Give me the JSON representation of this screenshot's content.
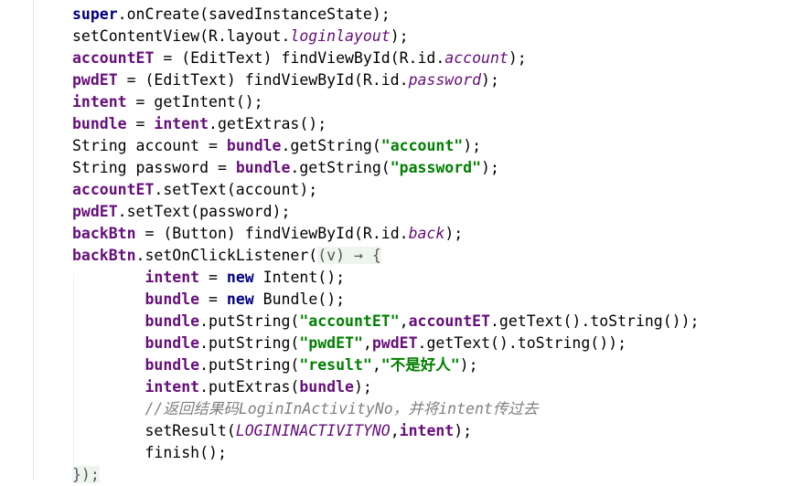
{
  "editor": {
    "lines": [
      [
        {
          "t": "super",
          "c": "kw"
        },
        {
          "t": ".onCreate(savedInstanceState);"
        }
      ],
      [
        {
          "t": "setContentView(R.layout."
        },
        {
          "t": "loginlayout",
          "c": "ifld"
        },
        {
          "t": ");"
        }
      ],
      [
        {
          "t": "accountET",
          "c": "fld"
        },
        {
          "t": " = (EditText) findViewById(R.id."
        },
        {
          "t": "account",
          "c": "ifld"
        },
        {
          "t": ");"
        }
      ],
      [
        {
          "t": "pwdET",
          "c": "fld"
        },
        {
          "t": " = (EditText) findViewById(R.id."
        },
        {
          "t": "password",
          "c": "ifld"
        },
        {
          "t": ");"
        }
      ],
      [
        {
          "t": "intent",
          "c": "fld"
        },
        {
          "t": " = getIntent();"
        }
      ],
      [
        {
          "t": "bundle",
          "c": "fld"
        },
        {
          "t": " = "
        },
        {
          "t": "intent",
          "c": "fld"
        },
        {
          "t": ".getExtras();"
        }
      ],
      [
        {
          "t": "String account = "
        },
        {
          "t": "bundle",
          "c": "fld"
        },
        {
          "t": ".getString("
        },
        {
          "t": "\"account\"",
          "c": "str"
        },
        {
          "t": ");"
        }
      ],
      [
        {
          "t": "String password = "
        },
        {
          "t": "bundle",
          "c": "fld"
        },
        {
          "t": ".getString("
        },
        {
          "t": "\"password\"",
          "c": "str"
        },
        {
          "t": ");"
        }
      ],
      [
        {
          "t": "accountET",
          "c": "fld"
        },
        {
          "t": ".setText(account);"
        }
      ],
      [
        {
          "t": "pwdET",
          "c": "fld"
        },
        {
          "t": ".setText(password);"
        }
      ],
      [
        {
          "t": "backBtn",
          "c": "fld"
        },
        {
          "t": " = (Button) findViewById(R.id."
        },
        {
          "t": "back",
          "c": "ifld"
        },
        {
          "t": ");"
        }
      ],
      [
        {
          "t": "backBtn",
          "c": "fld"
        },
        {
          "t": ".setOnClickListener("
        },
        {
          "t": "(v) → {",
          "c": "lam"
        }
      ],
      [
        {
          "t": "        "
        },
        {
          "t": "intent",
          "c": "fld"
        },
        {
          "t": " = "
        },
        {
          "t": "new",
          "c": "kw"
        },
        {
          "t": " Intent();"
        }
      ],
      [
        {
          "t": "        "
        },
        {
          "t": "bundle",
          "c": "fld"
        },
        {
          "t": " = "
        },
        {
          "t": "new",
          "c": "kw"
        },
        {
          "t": " Bundle();"
        }
      ],
      [
        {
          "t": "        "
        },
        {
          "t": "bundle",
          "c": "fld"
        },
        {
          "t": ".putString("
        },
        {
          "t": "\"accountET\"",
          "c": "str"
        },
        {
          "t": ","
        },
        {
          "t": "accountET",
          "c": "fld"
        },
        {
          "t": ".getText().toString());"
        }
      ],
      [
        {
          "t": "        "
        },
        {
          "t": "bundle",
          "c": "fld"
        },
        {
          "t": ".putString("
        },
        {
          "t": "\"pwdET\"",
          "c": "str"
        },
        {
          "t": ","
        },
        {
          "t": "pwdET",
          "c": "fld"
        },
        {
          "t": ".getText().toString());"
        }
      ],
      [
        {
          "t": "        "
        },
        {
          "t": "bundle",
          "c": "fld"
        },
        {
          "t": ".putString("
        },
        {
          "t": "\"result\"",
          "c": "str"
        },
        {
          "t": ","
        },
        {
          "t": "\"不是好人\"",
          "c": "str"
        },
        {
          "t": ");"
        }
      ],
      [
        {
          "t": "        "
        },
        {
          "t": "intent",
          "c": "fld"
        },
        {
          "t": ".putExtras("
        },
        {
          "t": "bundle",
          "c": "fld"
        },
        {
          "t": ");"
        }
      ],
      [
        {
          "t": "        "
        },
        {
          "t": "//返回结果码LoginInActivityNo，并将intent传过去",
          "c": "cmt"
        }
      ],
      [
        {
          "t": "        setResult("
        },
        {
          "t": "LOGININACTIVITYNO",
          "c": "ifld"
        },
        {
          "t": ","
        },
        {
          "t": "intent",
          "c": "fld"
        },
        {
          "t": ");"
        }
      ],
      [
        {
          "t": "        finish();"
        }
      ],
      [
        {
          "t": "});",
          "c": "lam"
        }
      ]
    ]
  }
}
